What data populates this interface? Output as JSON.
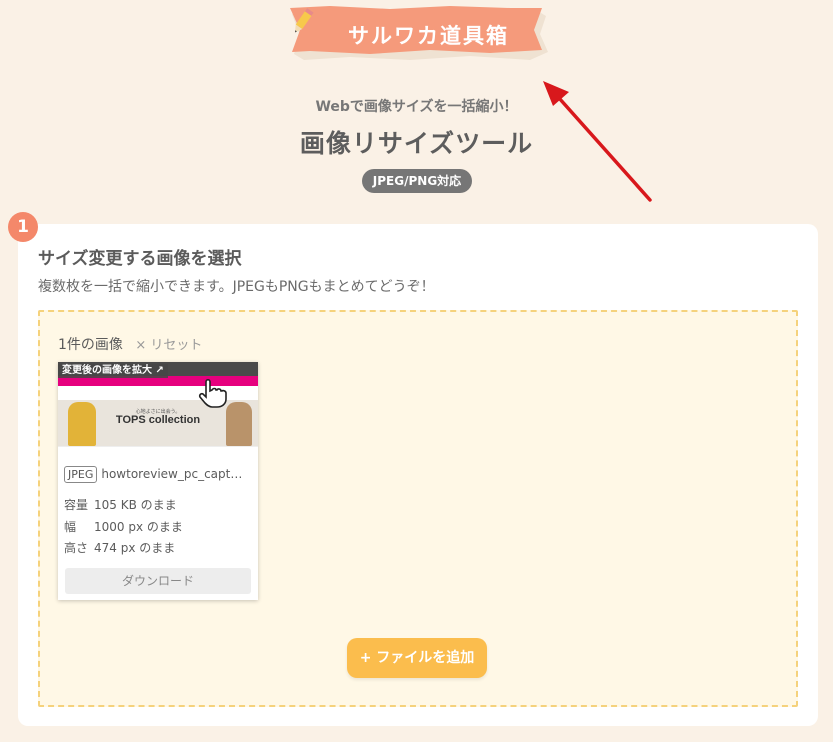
{
  "header": {
    "logo_text": "サルワカ道具箱",
    "tagline": "Webで画像サイズを一括縮小！",
    "title": "画像リサイズツール",
    "format_badge": "JPEG/PNG対応"
  },
  "colors": {
    "background": "#faf1e6",
    "logo_ribbon": "#f59a7b",
    "step_badge": "#f4886a",
    "dropzone_border": "#f5d27c",
    "dropzone_bg": "#fff8e6",
    "add_button": "#fbbd4d",
    "arrow": "#d8181c"
  },
  "step": {
    "number": "1",
    "title": "サイズ変更する画像を選択",
    "description": "複数枚を一括で縮小できます。JPEGもPNGもまとめてどうぞ！"
  },
  "dropzone": {
    "count_label": "1件の画像",
    "reset_label": "× リセット",
    "add_button_label": "+ ファイルを追加"
  },
  "image_item": {
    "enlarge_label": "変更後の画像を拡大 ↗",
    "thumb_text": "TOPS collection",
    "thumb_subtext": "心地よさに出会う。",
    "type": "JPEG",
    "file_name": "howtoreview_pc_captur...",
    "size_label": "容量",
    "size_value": "105 KB のまま",
    "width_label": "幅",
    "width_value": "1000 px のまま",
    "height_label": "高さ",
    "height_value": "474 px のまま",
    "download_label": "ダウンロード"
  },
  "icons": [
    "pencil-icon",
    "hand-pointer-icon",
    "annotation-arrow-icon"
  ]
}
